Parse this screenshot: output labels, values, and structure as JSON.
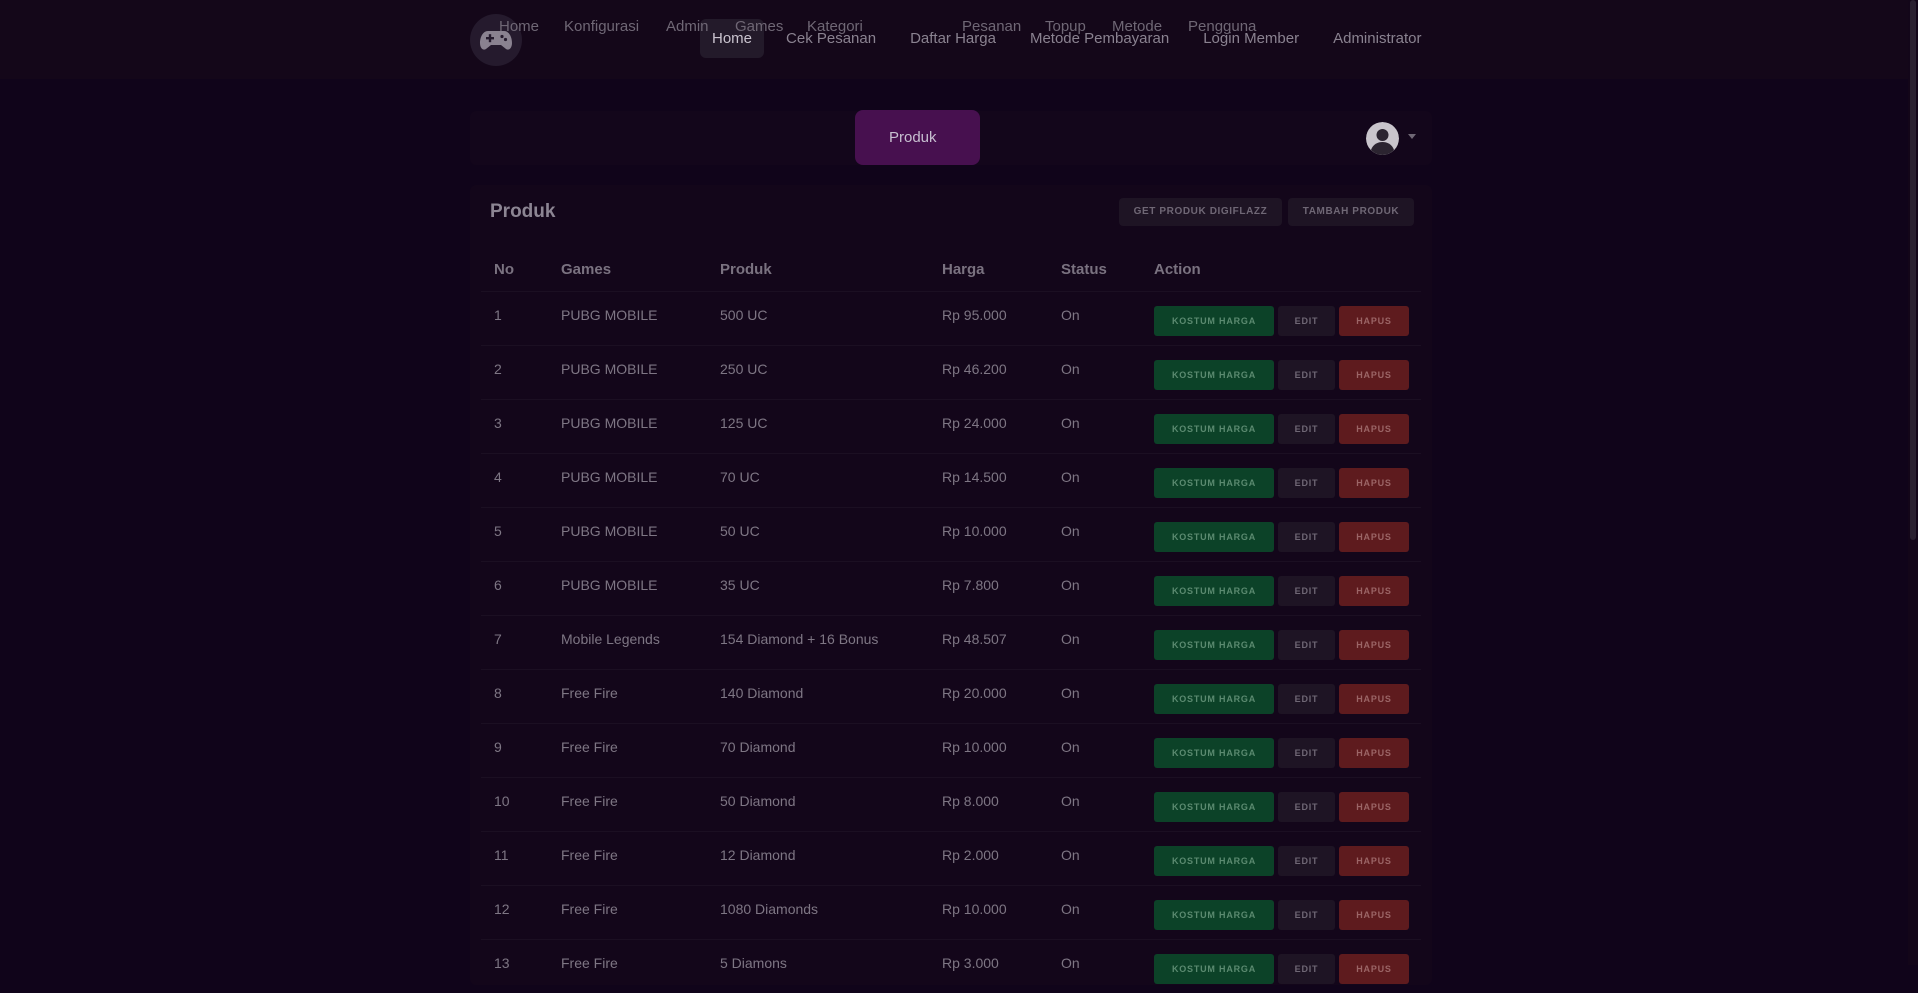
{
  "topnav": {
    "items": [
      {
        "label": "Home",
        "active": true
      },
      {
        "label": "Cek Pesanan",
        "active": false
      },
      {
        "label": "Daftar Harga",
        "active": false
      },
      {
        "label": "Metode Pembayaran",
        "active": false
      },
      {
        "label": "Login Member",
        "active": false
      },
      {
        "label": "Administrator",
        "active": false
      }
    ]
  },
  "adminbar": {
    "items": [
      {
        "label": "Home"
      },
      {
        "label": "Konfigurasi"
      },
      {
        "label": "Admin"
      },
      {
        "label": "Games"
      },
      {
        "label": "Kategori"
      },
      {
        "label": "Produk"
      },
      {
        "label": "Pesanan"
      },
      {
        "label": "Topup"
      },
      {
        "label": "Metode"
      },
      {
        "label": "Pengguna"
      }
    ],
    "active_label": "Produk"
  },
  "card": {
    "title": "Produk",
    "get_button": "GET PRODUK DIGIFLAZZ",
    "add_button": "TAMBAH PRODUK"
  },
  "table": {
    "headers": {
      "no": "No",
      "games": "Games",
      "produk": "Produk",
      "harga": "Harga",
      "status": "Status",
      "action": "Action"
    },
    "actions": {
      "custom": "KOSTUM HARGA",
      "edit": "EDIT",
      "delete": "HAPUS"
    },
    "rows": [
      {
        "no": "1",
        "games": "PUBG MOBILE",
        "produk": "500 UC",
        "harga": "Rp 95.000",
        "status": "On"
      },
      {
        "no": "2",
        "games": "PUBG MOBILE",
        "produk": "250 UC",
        "harga": "Rp 46.200",
        "status": "On"
      },
      {
        "no": "3",
        "games": "PUBG MOBILE",
        "produk": "125 UC",
        "harga": "Rp 24.000",
        "status": "On"
      },
      {
        "no": "4",
        "games": "PUBG MOBILE",
        "produk": "70 UC",
        "harga": "Rp 14.500",
        "status": "On"
      },
      {
        "no": "5",
        "games": "PUBG MOBILE",
        "produk": "50 UC",
        "harga": "Rp 10.000",
        "status": "On"
      },
      {
        "no": "6",
        "games": "PUBG MOBILE",
        "produk": "35 UC",
        "harga": "Rp 7.800",
        "status": "On"
      },
      {
        "no": "7",
        "games": "Mobile Legends",
        "produk": "154 Diamond + 16 Bonus",
        "harga": "Rp 48.507",
        "status": "On"
      },
      {
        "no": "8",
        "games": "Free Fire",
        "produk": "140 Diamond",
        "harga": "Rp 20.000",
        "status": "On"
      },
      {
        "no": "9",
        "games": "Free Fire",
        "produk": "70 Diamond",
        "harga": "Rp 10.000",
        "status": "On"
      },
      {
        "no": "10",
        "games": "Free Fire",
        "produk": "50 Diamond",
        "harga": "Rp 8.000",
        "status": "On"
      },
      {
        "no": "11",
        "games": "Free Fire",
        "produk": "12 Diamond",
        "harga": "Rp 2.000",
        "status": "On"
      },
      {
        "no": "12",
        "games": "Free Fire",
        "produk": "1080 Diamonds",
        "harga": "Rp 10.000",
        "status": "On"
      },
      {
        "no": "13",
        "games": "Free Fire",
        "produk": "5 Diamons",
        "harga": "Rp 3.000",
        "status": "On"
      }
    ]
  },
  "icons": {
    "logo": "gamepad-icon",
    "avatar": "user-avatar-icon",
    "caret": "caret-down-icon"
  }
}
